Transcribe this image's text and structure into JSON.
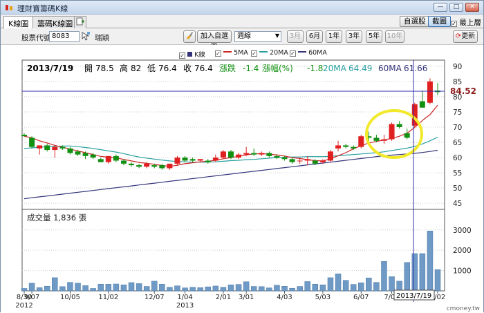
{
  "window": {
    "title": "理財寶籌碼K線",
    "min": "—",
    "max": "□",
    "close": "✕"
  },
  "tabs": [
    {
      "label": "K線圖",
      "active": true
    },
    {
      "label": "籌碼K線圖",
      "active": false
    }
  ],
  "top_buttons": {
    "watchlist": "自選股",
    "screenshot": "截圖",
    "ontop": "最上層"
  },
  "toolbar": {
    "stock_label": "股票代號:",
    "stock_code": "8083",
    "stock_name": "瑞穎",
    "add_watch": "加入自選股",
    "period": "週線",
    "ranges": [
      "3月",
      "6月",
      "1年",
      "3年",
      "5年",
      "10年"
    ],
    "update": "更新"
  },
  "legend": [
    {
      "label": "K線",
      "color": "#33337a"
    },
    {
      "label": "5MA",
      "color": "#cc2222"
    },
    {
      "label": "20MA",
      "color": "#2a9f9f"
    },
    {
      "label": "60MA",
      "color": "#33337a"
    }
  ],
  "info": {
    "date": "2013/7/19",
    "open_label": "開",
    "open": "78.5",
    "high_label": "高",
    "high": "82",
    "low_label": "低",
    "low": "76.4",
    "close_label": "收",
    "close": "76.4",
    "chg_label": "漲跌",
    "chg": "-1.4",
    "pct_label": "漲幅(%)",
    "pct": "-1.8",
    "ma20_label": "20MA",
    "ma20": "64.49",
    "ma60_label": "60MA",
    "ma60": "61.66"
  },
  "price_marker": "84.52",
  "volume_label": "成交量 1,836 張",
  "cursor_date": "2013/7/19",
  "watermark": "cmoney.tw",
  "colors": {
    "up": "#e02020",
    "down": "#129012",
    "ma5": "#cc2222",
    "ma20": "#2a9f9f",
    "ma60": "#33337a",
    "vol": "#6f9ac6",
    "grid": "#d0d0d0",
    "highlight": "#f2e92a",
    "cursor": "#3030b0"
  },
  "chart_data": {
    "type": "candlestick",
    "price_axis": {
      "ticks": [
        45,
        50,
        55,
        60,
        65,
        70,
        75,
        80,
        85,
        90
      ],
      "range": [
        43,
        92
      ]
    },
    "volume_axis": {
      "ticks": [
        1000,
        2000,
        3000
      ],
      "range": [
        0,
        3400
      ]
    },
    "x_labels": [
      {
        "i": 0,
        "label": "8/30"
      },
      {
        "i": 1,
        "label": "9/07"
      },
      {
        "i": 6,
        "label": "10/05"
      },
      {
        "i": 11,
        "label": "11/02"
      },
      {
        "i": 17,
        "label": "12/07"
      },
      {
        "i": 21,
        "label": "1/04"
      },
      {
        "i": 26,
        "label": "2/01"
      },
      {
        "i": 29,
        "label": "3/01"
      },
      {
        "i": 34,
        "label": "4/03"
      },
      {
        "i": 39,
        "label": "5/03"
      },
      {
        "i": 44,
        "label": "6/07"
      },
      {
        "i": 48,
        "label": "7/05"
      },
      {
        "i": 54,
        "label": "8/02"
      }
    ],
    "year_labels": [
      {
        "i": 0,
        "label": "2012"
      },
      {
        "i": 21,
        "label": "2013"
      }
    ],
    "candles": [
      {
        "o": 67.5,
        "h": 68,
        "l": 67,
        "c": 67,
        "v": 120
      },
      {
        "o": 66.5,
        "h": 67,
        "l": 63,
        "c": 63.5,
        "v": 380
      },
      {
        "o": 63,
        "h": 64,
        "l": 61,
        "c": 64,
        "v": 160
      },
      {
        "o": 64,
        "h": 64.5,
        "l": 62,
        "c": 62.5,
        "v": 230
      },
      {
        "o": 62.5,
        "h": 64,
        "l": 60,
        "c": 63.5,
        "v": 650
      },
      {
        "o": 63.5,
        "h": 64,
        "l": 62.5,
        "c": 63,
        "v": 210
      },
      {
        "o": 63,
        "h": 63.5,
        "l": 61,
        "c": 61.5,
        "v": 420
      },
      {
        "o": 62,
        "h": 62.5,
        "l": 60.5,
        "c": 61,
        "v": 380
      },
      {
        "o": 61.5,
        "h": 62,
        "l": 59.5,
        "c": 60.5,
        "v": 260
      },
      {
        "o": 61,
        "h": 61.5,
        "l": 59.5,
        "c": 60,
        "v": 120
      },
      {
        "o": 59.5,
        "h": 60,
        "l": 58.5,
        "c": 58.5,
        "v": 330
      },
      {
        "o": 58.5,
        "h": 60.5,
        "l": 58,
        "c": 60.5,
        "v": 330
      },
      {
        "o": 60.5,
        "h": 61,
        "l": 58.5,
        "c": 59,
        "v": 340
      },
      {
        "o": 59,
        "h": 59.5,
        "l": 57.5,
        "c": 58,
        "v": 300
      },
      {
        "o": 58,
        "h": 58.5,
        "l": 57,
        "c": 57.5,
        "v": 410
      },
      {
        "o": 57.5,
        "h": 58,
        "l": 56.5,
        "c": 57,
        "v": 360
      },
      {
        "o": 57,
        "h": 58.5,
        "l": 56.5,
        "c": 58,
        "v": 220
      },
      {
        "o": 57.5,
        "h": 58,
        "l": 56.5,
        "c": 57,
        "v": 480
      },
      {
        "o": 57.5,
        "h": 58,
        "l": 56,
        "c": 56.5,
        "v": 330
      },
      {
        "o": 56.5,
        "h": 58,
        "l": 56,
        "c": 58,
        "v": 180
      },
      {
        "o": 58,
        "h": 60.5,
        "l": 57.5,
        "c": 60,
        "v": 250
      },
      {
        "o": 60,
        "h": 60.5,
        "l": 58.5,
        "c": 59,
        "v": 150
      },
      {
        "o": 59.5,
        "h": 60,
        "l": 58.5,
        "c": 59,
        "v": 180
      },
      {
        "o": 59,
        "h": 59.5,
        "l": 58.5,
        "c": 59.5,
        "v": 160
      },
      {
        "o": 59,
        "h": 59.5,
        "l": 58,
        "c": 58.5,
        "v": 200
      },
      {
        "o": 59,
        "h": 61,
        "l": 58.5,
        "c": 60,
        "v": 240
      },
      {
        "o": 60,
        "h": 62.5,
        "l": 59.5,
        "c": 62,
        "v": 180
      },
      {
        "o": 62,
        "h": 62.5,
        "l": 59.5,
        "c": 60,
        "v": 300
      },
      {
        "o": 60,
        "h": 61.5,
        "l": 59.5,
        "c": 61,
        "v": 320
      },
      {
        "o": 61,
        "h": 63.5,
        "l": 60.5,
        "c": 61.5,
        "v": 450
      },
      {
        "o": 61.5,
        "h": 63,
        "l": 60.5,
        "c": 61,
        "v": 220
      },
      {
        "o": 61,
        "h": 62,
        "l": 60.5,
        "c": 61.5,
        "v": 210
      },
      {
        "o": 61.5,
        "h": 62,
        "l": 60,
        "c": 60.5,
        "v": 150
      },
      {
        "o": 60.5,
        "h": 61,
        "l": 59.5,
        "c": 60,
        "v": 280
      },
      {
        "o": 60,
        "h": 60.5,
        "l": 59,
        "c": 59.5,
        "v": 230
      },
      {
        "o": 59.5,
        "h": 60,
        "l": 58,
        "c": 58.5,
        "v": 130
      },
      {
        "o": 59,
        "h": 60,
        "l": 58,
        "c": 59,
        "v": 220
      },
      {
        "o": 59,
        "h": 60.5,
        "l": 57.5,
        "c": 59.5,
        "v": 460
      },
      {
        "o": 59,
        "h": 59.5,
        "l": 57.5,
        "c": 58,
        "v": 330
      },
      {
        "o": 58.5,
        "h": 59.5,
        "l": 58,
        "c": 59,
        "v": 300
      },
      {
        "o": 59,
        "h": 62.5,
        "l": 58.5,
        "c": 62,
        "v": 650
      },
      {
        "o": 63,
        "h": 65.5,
        "l": 62,
        "c": 64,
        "v": 840
      },
      {
        "o": 64,
        "h": 64.5,
        "l": 63,
        "c": 63.5,
        "v": 520
      },
      {
        "o": 63.5,
        "h": 64,
        "l": 62.5,
        "c": 63,
        "v": 320
      },
      {
        "o": 63.5,
        "h": 67.5,
        "l": 63,
        "c": 67,
        "v": 400
      },
      {
        "o": 67,
        "h": 68.5,
        "l": 65.5,
        "c": 66.5,
        "v": 640
      },
      {
        "o": 66.5,
        "h": 67.5,
        "l": 65,
        "c": 65.5,
        "v": 420
      },
      {
        "o": 65.5,
        "h": 67.5,
        "l": 64.5,
        "c": 66,
        "v": 1450
      },
      {
        "o": 66,
        "h": 71.5,
        "l": 65.5,
        "c": 71,
        "v": 700
      },
      {
        "o": 71,
        "h": 72,
        "l": 69.5,
        "c": 70,
        "v": 480
      },
      {
        "o": 68,
        "h": 69.5,
        "l": 66,
        "c": 66.5,
        "v": 1400
      },
      {
        "o": 70.5,
        "h": 78,
        "l": 70,
        "c": 77.5,
        "v": 1836
      },
      {
        "o": 78.5,
        "h": 82,
        "l": 76.4,
        "c": 76.4,
        "v": 1836
      },
      {
        "o": 78,
        "h": 86,
        "l": 77.5,
        "c": 85,
        "v": 2950
      },
      {
        "o": 82,
        "h": 84.5,
        "l": 80.5,
        "c": 81.5,
        "v": 1050
      }
    ],
    "ma5": [
      67,
      66.5,
      65.5,
      64.8,
      64,
      63.4,
      62.8,
      62.2,
      61.6,
      61,
      60.4,
      60.1,
      59.9,
      59.4,
      58.9,
      58.4,
      58.1,
      57.8,
      57.4,
      57.1,
      57.5,
      58,
      58.3,
      58.6,
      58.8,
      59.1,
      59.6,
      60,
      60.4,
      60.9,
      61.2,
      61.3,
      61.1,
      60.9,
      60.5,
      60,
      59.7,
      59.3,
      59,
      58.9,
      59.6,
      60.6,
      61.6,
      62.9,
      63.9,
      64.8,
      65.3,
      65.8,
      66.3,
      67,
      68,
      69.9,
      72.2,
      74.1,
      77.2
    ],
    "ma20": [
      63,
      63.2,
      63.4,
      63.6,
      63.7,
      63.8,
      63.8,
      63.6,
      63.3,
      63,
      62.6,
      62.2,
      61.8,
      61.3,
      60.7,
      60.2,
      59.8,
      59.5,
      59.2,
      58.9,
      58.7,
      58.6,
      58.5,
      58.5,
      58.5,
      58.6,
      58.8,
      59,
      59.1,
      59.3,
      59.4,
      59.6,
      59.8,
      60,
      60.1,
      60.2,
      60.2,
      60.3,
      60.3,
      60.3,
      60.4,
      60.6,
      60.8,
      61,
      61.2,
      61.4,
      61.6,
      61.9,
      62.3,
      62.7,
      63.1,
      63.7,
      64.49,
      65.5,
      66.7
    ],
    "ma60": [
      46.5,
      46.8,
      47.1,
      47.4,
      47.7,
      48,
      48.3,
      48.6,
      48.9,
      49.2,
      49.5,
      49.8,
      50.1,
      50.4,
      50.7,
      51,
      51.3,
      51.6,
      51.9,
      52.2,
      52.5,
      52.8,
      53.1,
      53.4,
      53.7,
      54,
      54.3,
      54.6,
      54.9,
      55.2,
      55.5,
      55.8,
      56.1,
      56.4,
      56.7,
      57,
      57.3,
      57.6,
      57.9,
      58.2,
      58.5,
      58.8,
      59.1,
      59.4,
      59.7,
      60,
      60.3,
      60.6,
      60.8,
      61,
      61.2,
      61.4,
      61.66,
      62,
      62.4
    ]
  }
}
